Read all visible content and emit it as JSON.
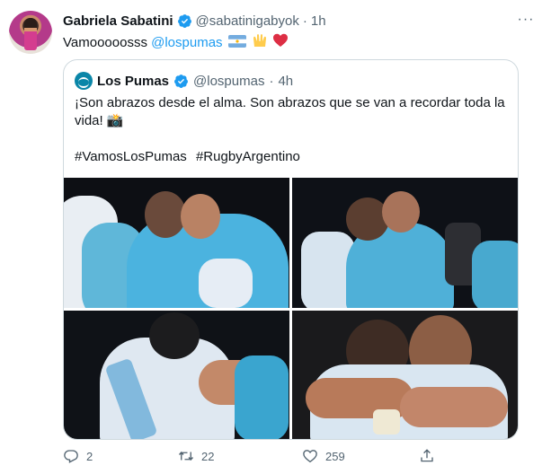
{
  "author": {
    "name": "Gabriela Sabatini",
    "handle": "@sabatinigabyok",
    "separator": "·",
    "time": "1h"
  },
  "tweet": {
    "text": "Vamooooosss ",
    "mention": "@lospumas"
  },
  "quote": {
    "name": "Los Pumas",
    "handle": "@lospumas",
    "separator": "·",
    "time": "4h",
    "text": "¡Son abrazos desde el alma. Son abrazos que se van a recordar toda la vida! 📸",
    "hashtags": [
      "#VamosLosPumas",
      "#RugbyArgentino"
    ]
  },
  "actions": {
    "replies": "2",
    "retweets": "22",
    "likes": "259"
  },
  "icons": {
    "more": "more-dots-icon",
    "verified": "verified-badge-icon",
    "reply": "reply-icon",
    "retweet": "retweet-icon",
    "like": "heart-icon",
    "share": "share-icon"
  },
  "colors": {
    "accent": "#1d9bf0",
    "muted": "#536471",
    "border": "#cfd9de",
    "text": "#0f1419"
  }
}
